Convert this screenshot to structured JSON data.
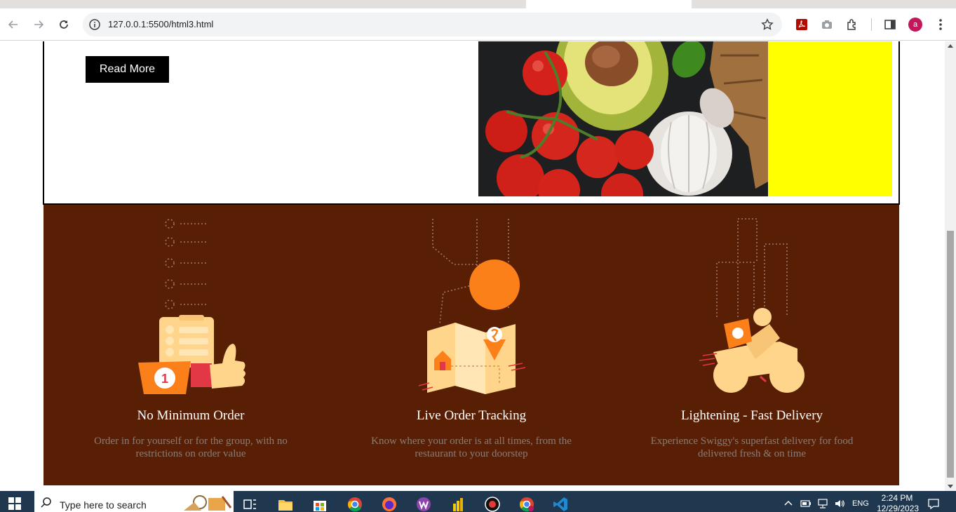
{
  "browser": {
    "url": "127.0.0.1:5500/html3.html",
    "profile_initial": "a"
  },
  "hero": {
    "read_more_label": "Read More",
    "accent_color": "#ffff00"
  },
  "features": [
    {
      "title": "No Minimum Order",
      "description": "Order in for yourself or for the group, with no restrictions on order value"
    },
    {
      "title": "Live Order Tracking",
      "description": "Know where your order is at all times, from the restaurant to your doorstep"
    },
    {
      "title": "Lightening - Fast Delivery",
      "description": "Experience Swiggy's superfast delivery for food delivered fresh & on time"
    }
  ],
  "colors": {
    "features_bg": "#581f05",
    "feature_orange": "#fc8019",
    "feature_cream": "#ffd48b"
  },
  "taskbar": {
    "search_placeholder": "Type here to search",
    "language": "ENG",
    "time": "2:24 PM",
    "date": "12/29/2023"
  }
}
